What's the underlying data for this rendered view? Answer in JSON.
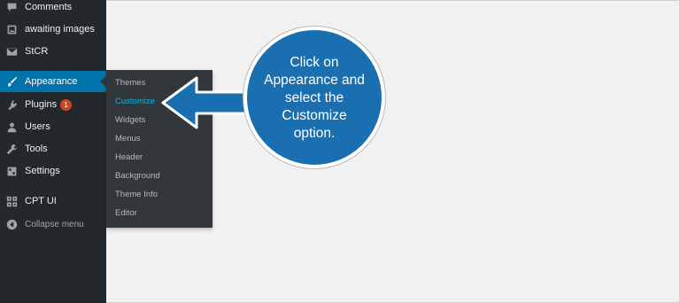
{
  "sidebar": {
    "items": [
      {
        "label": "Comments",
        "icon": "comment-icon"
      },
      {
        "label": "awaiting images",
        "icon": "image-icon"
      },
      {
        "label": "StCR",
        "icon": "mail-icon"
      },
      {
        "label": "Appearance",
        "icon": "paintbrush-icon",
        "active": true
      },
      {
        "label": "Plugins",
        "icon": "plug-icon",
        "badge": "1"
      },
      {
        "label": "Users",
        "icon": "user-icon"
      },
      {
        "label": "Tools",
        "icon": "wrench-icon"
      },
      {
        "label": "Settings",
        "icon": "settings-icon"
      },
      {
        "label": "CPT UI",
        "icon": "grid-icon"
      },
      {
        "label": "Collapse menu",
        "icon": "collapse-icon"
      }
    ]
  },
  "submenu": {
    "items": [
      "Themes",
      "Customize",
      "Widgets",
      "Menus",
      "Header",
      "Background",
      "Theme Info",
      "Editor"
    ],
    "current": "Customize"
  },
  "callout": {
    "text": "Click on\nAppearance and\nselect the\nCustomize\noption."
  },
  "colors": {
    "sidebar_bg": "#23282d",
    "active_bg": "#0073aa",
    "submenu_bg": "#32373c",
    "current_link": "#00b9eb",
    "callout_bg": "#1a6fb0",
    "badge": "#ca4a1f"
  }
}
